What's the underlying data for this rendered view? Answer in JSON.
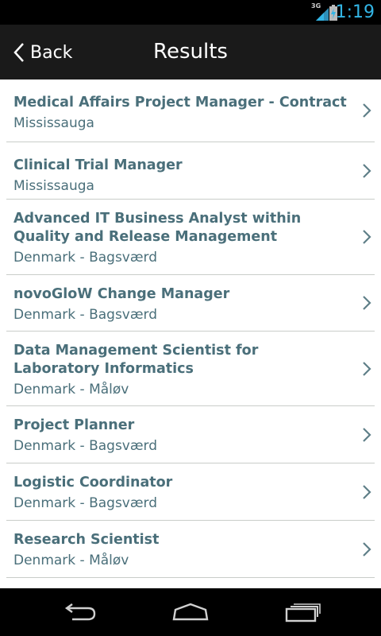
{
  "status_bar": {
    "network_type": "3G",
    "time": "1:19",
    "icons": [
      "signal-icon",
      "battery-charging-icon"
    ],
    "accent_color": "#33b5e5"
  },
  "action_bar": {
    "back_label": "Back",
    "title": "Results"
  },
  "results": [
    {
      "title": "Medical Affairs Project Manager - Contract",
      "location": "Mississauga"
    },
    {
      "title": "Clinical Trial Manager",
      "location": "Mississauga"
    },
    {
      "title": "Advanced IT Business Analyst within\nQuality and Release Management",
      "location": "Denmark - Bagsværd"
    },
    {
      "title": "novoGloW Change Manager",
      "location": "Denmark - Bagsværd"
    },
    {
      "title": "Data Management Scientist for\nLaboratory Informatics",
      "location": "Denmark - Måløv"
    },
    {
      "title": "Project Planner",
      "location": "Denmark - Bagsværd"
    },
    {
      "title": "Logistic Coordinator",
      "location": "Denmark - Bagsværd"
    },
    {
      "title": "Research Scientist",
      "location": "Denmark - Måløv"
    }
  ],
  "colors": {
    "text": "#4a6f7a",
    "divider": "#c9cdc9",
    "action_bar": "#1a1a1a"
  },
  "nav_bar": {
    "icons": [
      "back-nav-icon",
      "home-icon",
      "recent-apps-icon"
    ]
  }
}
